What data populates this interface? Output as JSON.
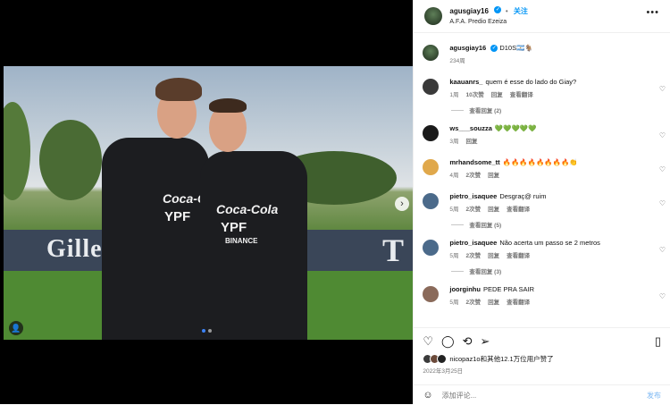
{
  "header": {
    "username": "agusgiay16",
    "follow_label": "关注",
    "location": "A.F.A. Predio Ezeiza",
    "more": "•••"
  },
  "caption": {
    "username": "agusgiay16",
    "text": "D10S🇦🇷🐐",
    "time": "234周"
  },
  "comments": [
    {
      "username": "kaauanrs_",
      "text": "quem é esse do lado do Giay?",
      "time": "1周",
      "likes": "10次赞",
      "reply": "回复",
      "translate": "查看翻译",
      "replies": "查看回复 (2)",
      "avatar_color": "#3a3a3a"
    },
    {
      "username": "ws___souzza",
      "text": "💚💚💚💚💚",
      "time": "3周",
      "likes": "",
      "reply": "回复",
      "translate": "",
      "replies": "",
      "avatar_color": "#1a1a1a"
    },
    {
      "username": "mrhandsome_tt",
      "text": "🔥🔥🔥🔥🔥🔥🔥🔥👏",
      "time": "4周",
      "likes": "2次赞",
      "reply": "回复",
      "translate": "",
      "replies": "",
      "avatar_color": "#e0a84b"
    },
    {
      "username": "pietro_isaquee",
      "text": "Desgraç@ ruim",
      "time": "5周",
      "likes": "2次赞",
      "reply": "回复",
      "translate": "查看翻译",
      "replies": "查看回复 (5)",
      "avatar_color": "#4b6a8a"
    },
    {
      "username": "pietro_isaquee",
      "text": "Não acerta um passo se 2 metros",
      "time": "5周",
      "likes": "2次赞",
      "reply": "回复",
      "translate": "查看翻译",
      "replies": "查看回复 (3)",
      "avatar_color": "#4b6a8a"
    },
    {
      "username": "joorginhu",
      "text": "PEDE PRA SAIR",
      "time": "5周",
      "likes": "2次赞",
      "reply": "回复",
      "translate": "查看翻译",
      "replies": "",
      "avatar_color": "#8a6a5a"
    }
  ],
  "footer": {
    "liked_by": "nicopaz1o和其他12.1万位用户赞了",
    "date": "2022年3月25日",
    "comment_placeholder": "添加评论...",
    "post_label": "发布"
  },
  "photo": {
    "banner_text": "Gillette",
    "banner_text2": "T",
    "kit_sponsor": "Coca-Cola",
    "kit_sponsor2": "YPF",
    "kit_sponsor3": "BINANCE"
  },
  "colors": {
    "accent": "#0095f6",
    "verified": "#0095f6"
  }
}
